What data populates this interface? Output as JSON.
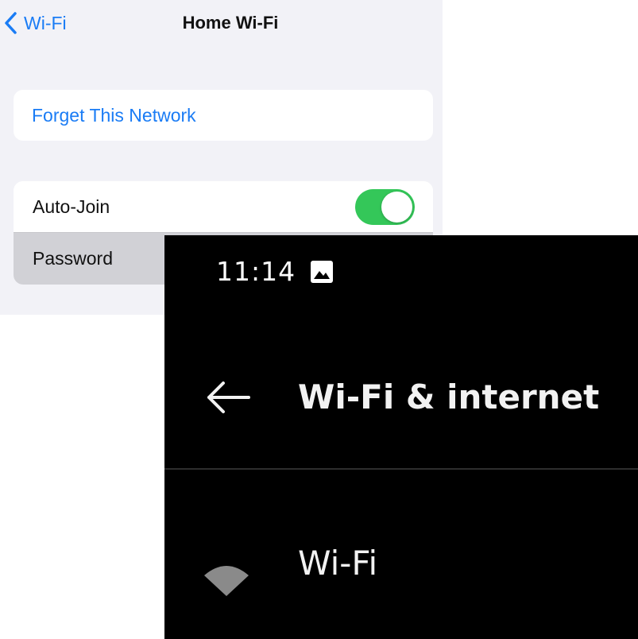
{
  "ios": {
    "nav": {
      "back_label": "Wi-Fi",
      "title": "Home Wi-Fi"
    },
    "forget_label": "Forget This Network",
    "auto_join": {
      "label": "Auto-Join",
      "enabled": true
    },
    "password_label": "Password",
    "colors": {
      "accent": "#1a7cf5",
      "toggle_on": "#34c759",
      "background": "#f2f2f7"
    }
  },
  "android": {
    "status_bar": {
      "time": "11:14",
      "notification_icon": "image-icon"
    },
    "toolbar": {
      "back_icon": "arrow-back-icon",
      "title": "Wi-Fi & internet"
    },
    "wifi_item": {
      "icon": "wifi-icon",
      "label": "Wi-Fi"
    },
    "colors": {
      "background": "#000000",
      "text": "#f2f2f2"
    }
  }
}
